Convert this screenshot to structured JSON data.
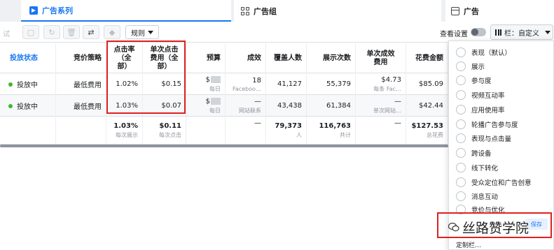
{
  "tabs": {
    "campaign": "广告系列",
    "adset": "广告组",
    "ad": "广告"
  },
  "toolbar": {
    "edit_label": "试",
    "rules_label": "规则",
    "view_settings_label": "查看设置",
    "columns_label": "栏：自定义"
  },
  "table": {
    "headers": {
      "status": "投放状态",
      "bid": "竞价策略",
      "ctr": "点击率（全部）",
      "cpc": "单次点击费用（全部）",
      "budget": "预算",
      "results": "成效",
      "reach": "覆盖人数",
      "impressions": "展示次数",
      "cost_per_result": "单次成效费用",
      "spend": "花费金额"
    },
    "rows": [
      {
        "status": "投放中",
        "bid": "最低费用",
        "ctr": "1.02%",
        "cpc": "$0.15",
        "budget_prefix": "$",
        "budget_sub": "每日",
        "results": "18",
        "results_sub": "Faceboo…",
        "reach": "41,127",
        "impressions": "55,379",
        "cost_per_result": "$4.73",
        "cost_per_result_sub": "每条 Fac…",
        "spend": "$85.09"
      },
      {
        "status": "投放中",
        "bid": "最低费用",
        "ctr": "1.03%",
        "cpc": "$0.07",
        "budget_prefix": "$",
        "budget_sub": "每日",
        "results": "—",
        "results_sub": "网站联系",
        "reach": "43,438",
        "impressions": "61,384",
        "cost_per_result": "—",
        "cost_per_result_sub": "单次网站…",
        "spend": "$42.44"
      }
    ],
    "totals": {
      "ctr": "1.03%",
      "ctr_sub": "每次展示",
      "cpc": "$0.11",
      "cpc_sub": "每次点击",
      "results": "—",
      "reach": "79,373",
      "reach_sub": "人",
      "impressions": "116,763",
      "impressions_sub": "共计",
      "cost_per_result": "—",
      "spend": "$127.53",
      "spend_sub": "总花费"
    }
  },
  "column_menu": {
    "options": [
      "表现（默认）",
      "展示",
      "参与度",
      "视频互动率",
      "应用使用率",
      "轮播广告参与度",
      "表现与点击量",
      "跨设备",
      "线下转化",
      "受众定位和广告创意",
      "消息互动",
      "竞价与优化"
    ],
    "save_label": "保存",
    "custom_label": "定制栏…"
  },
  "watermark": {
    "text": "丝路赞学院"
  },
  "colors": {
    "accent": "#1877f2",
    "highlight_box": "#e02020",
    "status_active": "#42b72a"
  }
}
